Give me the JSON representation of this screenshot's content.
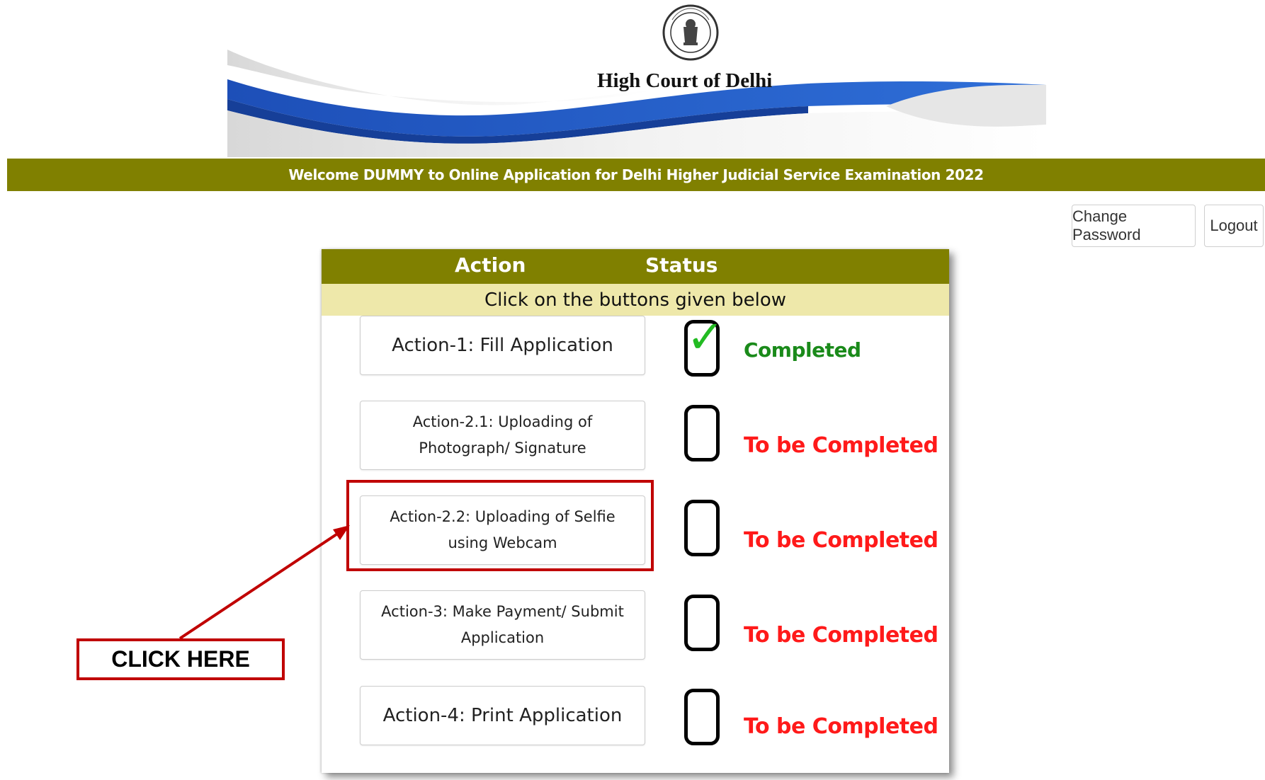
{
  "header": {
    "court_name": "High Court of Delhi",
    "emblem_icon": "delhi-high-court-emblem-icon"
  },
  "welcome": {
    "text": "Welcome DUMMY to Online Application for Delhi Higher Judicial Service Examination 2022"
  },
  "top_buttons": {
    "change_password": "Change Password",
    "logout": "Logout"
  },
  "panel": {
    "head_action": "Action",
    "head_status": "Status",
    "instruction": "Click on the buttons given below",
    "actions": [
      {
        "label": "Action-1: Fill Application",
        "status": "Completed",
        "checked": true
      },
      {
        "label": "Action-2.1: Uploading of Photograph/ Signature",
        "status": "To be Completed",
        "checked": false
      },
      {
        "label": "Action-2.2: Uploading of Selfie using Webcam",
        "status": "To be Completed",
        "checked": false
      },
      {
        "label": "Action-3: Make Payment/ Submit Application",
        "status": "To be Completed",
        "checked": false
      },
      {
        "label": "Action-4: Print Application",
        "status": "To be Completed",
        "checked": false
      }
    ]
  },
  "annotation": {
    "callout": "CLICK HERE"
  },
  "colors": {
    "olive": "#808000",
    "khaki": "#eee8aa",
    "completed": "#1a8a1a",
    "pending": "#ff1a1a",
    "annotation_red": "#c00000",
    "banner_blue": "#1f5fc8"
  }
}
